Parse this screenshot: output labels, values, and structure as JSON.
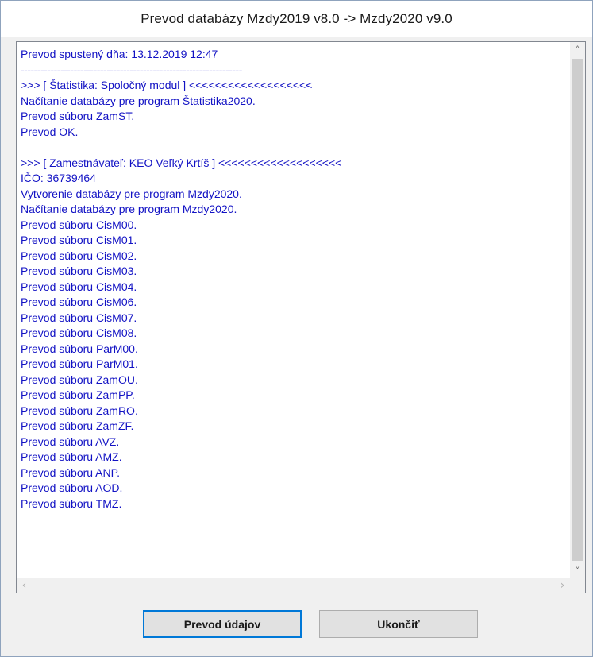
{
  "window": {
    "title": "Prevod databázy Mzdy2019 v8.0 ->  Mzdy2020 v9.0"
  },
  "log": {
    "lines": [
      "Prevod spustený dňa: 13.12.2019 12:47",
      "-------------------------------------------------------------------",
      ">>> [ Štatistika: Spoločný modul ] <<<<<<<<<<<<<<<<<<<",
      "Načítanie databázy pre program Štatistika2020.",
      "Prevod súboru ZamST.",
      "Prevod OK.",
      "",
      ">>> [ Zamestnávateľ: KEO Veľký Krtíš ] <<<<<<<<<<<<<<<<<<<",
      "IČO: 36739464",
      "Vytvorenie databázy pre program Mzdy2020.",
      "Načítanie databázy pre program Mzdy2020.",
      "Prevod súboru CisM00.",
      "Prevod súboru CisM01.",
      "Prevod súboru CisM02.",
      "Prevod súboru CisM03.",
      "Prevod súboru CisM04.",
      "Prevod súboru CisM06.",
      "Prevod súboru CisM07.",
      "Prevod súboru CisM08.",
      "Prevod súboru ParM00.",
      "Prevod súboru ParM01.",
      "Prevod súboru ZamOU.",
      "Prevod súboru ZamPP.",
      "Prevod súboru ZamRO.",
      "Prevod súboru ZamZF.",
      "Prevod súboru AVZ.",
      "Prevod súboru AMZ.",
      "Prevod súboru ANP.",
      "Prevod súboru AOD.",
      "Prevod súboru TMZ."
    ]
  },
  "buttons": {
    "convert_label": "Prevod údajov",
    "close_label": "Ukončiť"
  },
  "icons": {
    "scroll_up": "chevron-up-icon",
    "scroll_down": "chevron-down-icon",
    "scroll_left": "chevron-left-icon",
    "scroll_right": "chevron-right-icon"
  },
  "colors": {
    "log_text": "#1212c4",
    "default_button_border": "#0078d7"
  }
}
